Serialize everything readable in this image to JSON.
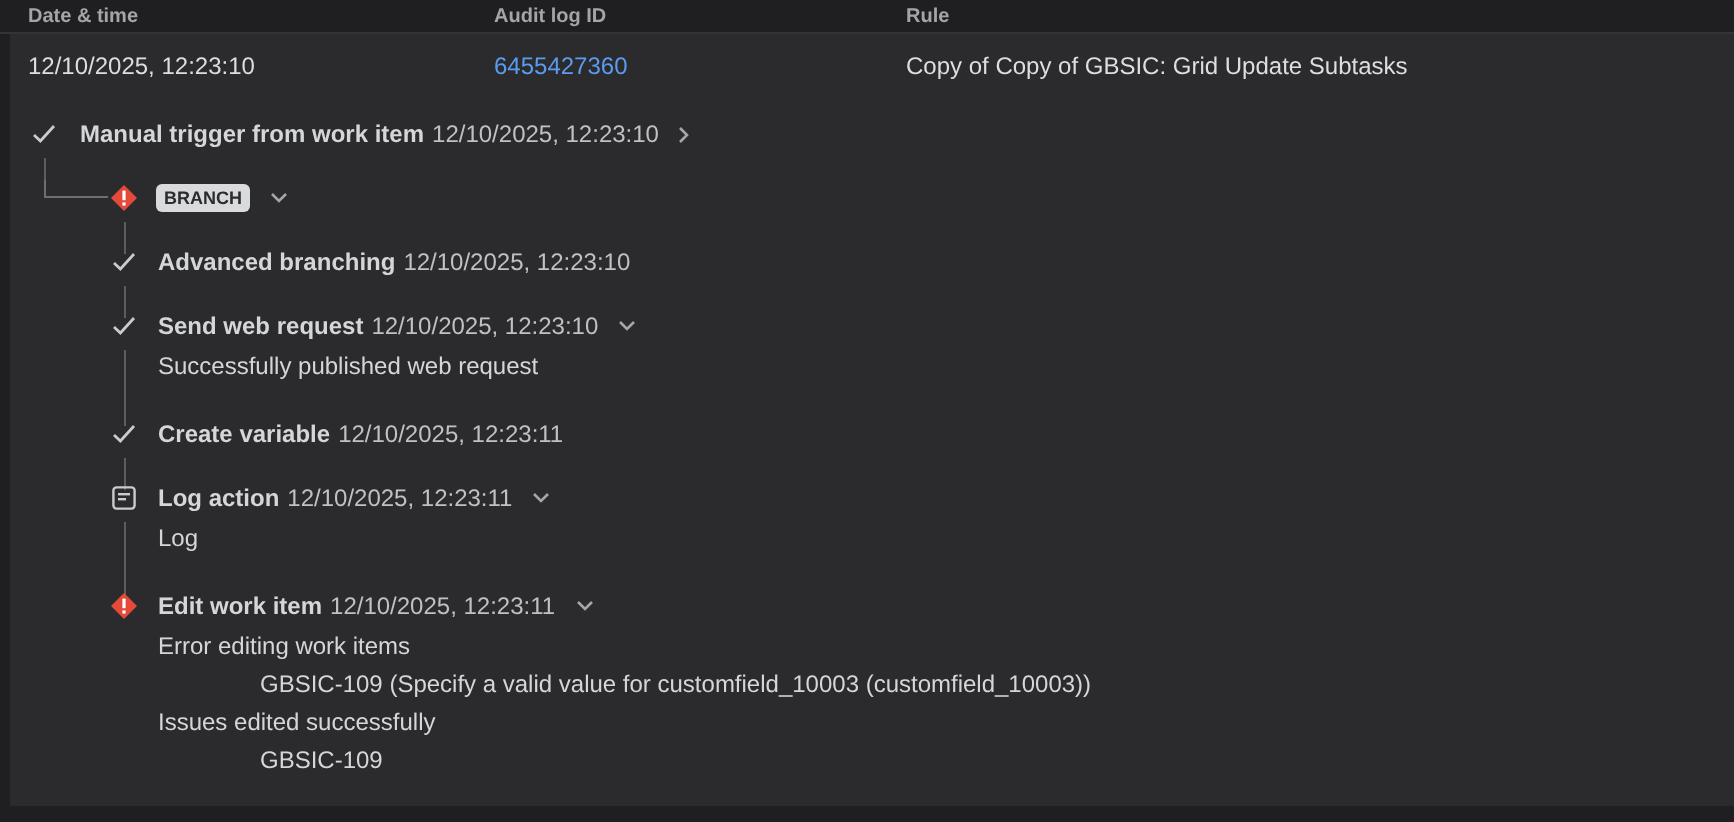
{
  "columns": [
    "Date & time",
    "Audit log ID",
    "Rule"
  ],
  "row": {
    "date": "12/10/2025, 12:23:10",
    "audit_id": "6455427360",
    "rule": "Copy of Copy of GBSIC: Grid Update Subtasks"
  },
  "trigger": {
    "kind": "success",
    "title": "Manual trigger from work item",
    "time": "12/10/2025, 12:23:10",
    "expanded": false
  },
  "branch": {
    "kind": "error",
    "badge": "BRANCH",
    "expanded": true,
    "children": [
      {
        "kind": "success",
        "title": "Advanced branching",
        "time": "12/10/2025, 12:23:10"
      },
      {
        "kind": "success",
        "title": "Send web request",
        "time": "12/10/2025, 12:23:10",
        "expanded": true,
        "details": [
          {
            "text": "Successfully published web request"
          }
        ]
      },
      {
        "kind": "success",
        "title": "Create variable",
        "time": "12/10/2025, 12:23:11"
      },
      {
        "kind": "log",
        "title": "Log action",
        "time": "12/10/2025, 12:23:11",
        "expanded": true,
        "details": [
          {
            "text": "Log"
          }
        ]
      },
      {
        "kind": "error",
        "title": "Edit work item",
        "time": "12/10/2025, 12:23:11",
        "expanded": true,
        "details": [
          {
            "text": "Error editing work items",
            "children": [
              {
                "text": "GBSIC-109 (Specify a valid value for customfield_10003 (customfield_10003))"
              }
            ]
          },
          {
            "text": "Issues edited successfully",
            "children": [
              {
                "text": "GBSIC-109"
              }
            ]
          }
        ]
      }
    ]
  }
}
